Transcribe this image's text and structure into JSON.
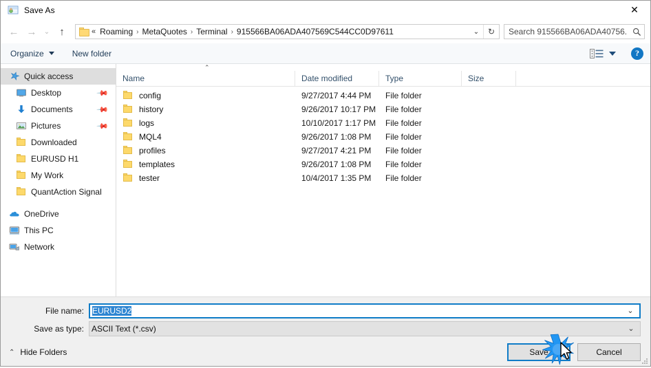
{
  "window": {
    "title": "Save As",
    "icon": "save-as-icon",
    "close_label": "✕"
  },
  "nav": {
    "back": "←",
    "forward": "→",
    "recent": "⌄",
    "up": "↑",
    "refresh": "↻",
    "dropdown": "⌄",
    "breadcrumb_prefix": "«",
    "breadcrumbs": [
      "Roaming",
      "MetaQuotes",
      "Terminal",
      "915566BA06ADA407569C544CC0D97611"
    ],
    "separator": "›"
  },
  "search": {
    "placeholder": "Search 915566BA06ADA40756...",
    "value": "",
    "icon": "search-icon"
  },
  "toolbar": {
    "organize_label": "Organize",
    "new_folder_label": "New folder",
    "view_icon": "view-layout-icon",
    "help_label": "?"
  },
  "sidebar": {
    "items": [
      {
        "label": "Quick access",
        "icon": "star-icon",
        "selected": true,
        "pinned": false,
        "group": "top"
      },
      {
        "label": "Desktop",
        "icon": "desktop-icon",
        "selected": false,
        "pinned": true,
        "group": "child"
      },
      {
        "label": "Documents",
        "icon": "documents-arrow-icon",
        "selected": false,
        "pinned": true,
        "group": "child"
      },
      {
        "label": "Pictures",
        "icon": "pictures-icon",
        "selected": false,
        "pinned": true,
        "group": "child"
      },
      {
        "label": "Downloaded",
        "icon": "folder-icon",
        "selected": false,
        "pinned": false,
        "group": "child"
      },
      {
        "label": "EURUSD H1",
        "icon": "folder-icon",
        "selected": false,
        "pinned": false,
        "group": "child"
      },
      {
        "label": "My Work",
        "icon": "folder-icon",
        "selected": false,
        "pinned": false,
        "group": "child"
      },
      {
        "label": "QuantAction Signal",
        "icon": "folder-icon",
        "selected": false,
        "pinned": false,
        "group": "child"
      },
      {
        "label": "OneDrive",
        "icon": "onedrive-cloud-icon",
        "selected": false,
        "pinned": false,
        "group": "root"
      },
      {
        "label": "This PC",
        "icon": "this-pc-icon",
        "selected": false,
        "pinned": false,
        "group": "root"
      },
      {
        "label": "Network",
        "icon": "network-icon",
        "selected": false,
        "pinned": false,
        "group": "root"
      }
    ]
  },
  "filelist": {
    "sort_indicator": "⌃",
    "columns": [
      "Name",
      "Date modified",
      "Type",
      "Size"
    ],
    "rows": [
      {
        "name": "config",
        "date": "9/27/2017 4:44 PM",
        "type": "File folder",
        "size": ""
      },
      {
        "name": "history",
        "date": "9/26/2017 10:17 PM",
        "type": "File folder",
        "size": ""
      },
      {
        "name": "logs",
        "date": "10/10/2017 1:17 PM",
        "type": "File folder",
        "size": ""
      },
      {
        "name": "MQL4",
        "date": "9/26/2017 1:08 PM",
        "type": "File folder",
        "size": ""
      },
      {
        "name": "profiles",
        "date": "9/27/2017 4:21 PM",
        "type": "File folder",
        "size": ""
      },
      {
        "name": "templates",
        "date": "9/26/2017 1:08 PM",
        "type": "File folder",
        "size": ""
      },
      {
        "name": "tester",
        "date": "10/4/2017 1:35 PM",
        "type": "File folder",
        "size": ""
      }
    ]
  },
  "form": {
    "filename_label": "File name:",
    "filename_value": "EURUSD2",
    "filetype_label": "Save as type:",
    "filetype_value": "ASCII Text (*.csv)",
    "combo_arrow": "⌄"
  },
  "footer": {
    "hide_folders_label": "Hide Folders",
    "hide_folders_caret": "⌃",
    "save_label": "Save",
    "cancel_label": "Cancel"
  },
  "colors": {
    "accent_blue": "#0f7cc7",
    "selection_blue": "#2f86d2",
    "folder_yellow": "#fdd96b",
    "header_text": "#33506b",
    "toolbar_bg": "#f7f9fb",
    "form_bg": "#f0f0f0"
  }
}
